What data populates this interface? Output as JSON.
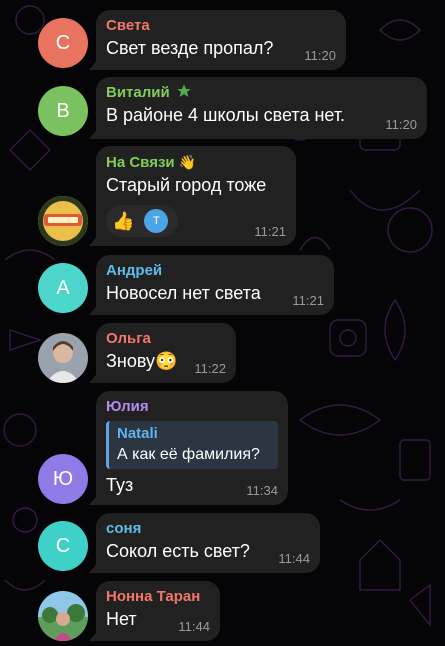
{
  "colors": {
    "background": "#050507",
    "bubble": "#212121",
    "time": "#9a9a9a",
    "reply_accent": "#5ea6e6"
  },
  "messages": [
    {
      "avatar_letter": "С",
      "avatar_color": "#e8735e",
      "author": "Света",
      "author_color": "#f2776b",
      "text": "Свет везде пропал?",
      "time": "11:20"
    },
    {
      "avatar_letter": "В",
      "avatar_color": "#79c25f",
      "author": "Виталий",
      "author_color": "#82cc5a",
      "author_icon": "star-icon",
      "text": "В районе 4 школы света нет.",
      "time": "11:20"
    },
    {
      "avatar_letter": "",
      "avatar_color": "#d9b23a",
      "author": "На Связи",
      "author_color": "#82cc5a",
      "author_icon": "wave-hand-icon",
      "text": "Старый город тоже",
      "time": "11:21",
      "reaction_emoji": "👍",
      "reaction_avatar_letter": "Т"
    },
    {
      "avatar_letter": "А",
      "avatar_color": "#4cd6cb",
      "author": "Андрей",
      "author_color": "#5ebde8",
      "text": "Новосел нет света",
      "time": "11:21"
    },
    {
      "avatar_letter": "",
      "avatar_color": "#8a8f98",
      "author": "Ольга",
      "author_color": "#f2776b",
      "text": "Знову😳",
      "time": "11:22"
    },
    {
      "avatar_letter": "Ю",
      "avatar_color": "#8f7ae6",
      "author": "Юлия",
      "author_color": "#b28cf0",
      "reply_author": "Natali",
      "reply_text": "А как её фамилия?",
      "text": "Туз",
      "time": "11:34"
    },
    {
      "avatar_letter": "С",
      "avatar_color": "#3fd0c8",
      "author": "соня",
      "author_color": "#5ebde8",
      "text": "Сокол есть свет?",
      "time": "11:44"
    },
    {
      "avatar_letter": "",
      "avatar_color": "#6aa08a",
      "author": "Нонна Таран",
      "author_color": "#f2776b",
      "text": "Нет",
      "time": "11:44"
    }
  ]
}
